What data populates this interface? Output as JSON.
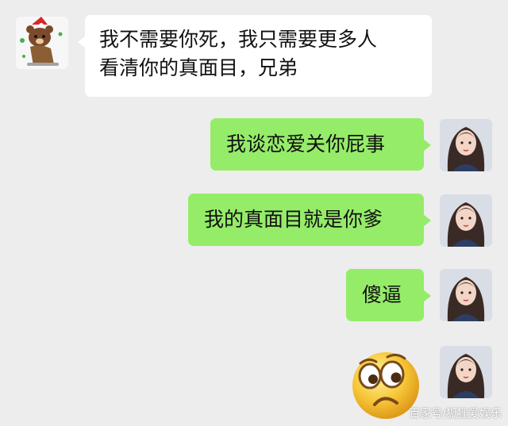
{
  "messages": [
    {
      "side": "left",
      "lines": [
        "我不需要你死，我只需要更多人",
        "看清你的真面目，兄弟"
      ]
    },
    {
      "side": "right",
      "text": "我谈恋爱关你屁事"
    },
    {
      "side": "right",
      "text": "我的真面目就是你爹"
    },
    {
      "side": "right",
      "text": "傻逼"
    },
    {
      "side": "right",
      "sticker": "confused-emoji"
    }
  ],
  "avatars": {
    "left": "bear-avatar",
    "right": "girl-avatar"
  },
  "watermark": "百家号/狐狸爱娱乐",
  "colors": {
    "background": "#ededed",
    "left_bubble": "#ffffff",
    "right_bubble": "#95ec69"
  }
}
